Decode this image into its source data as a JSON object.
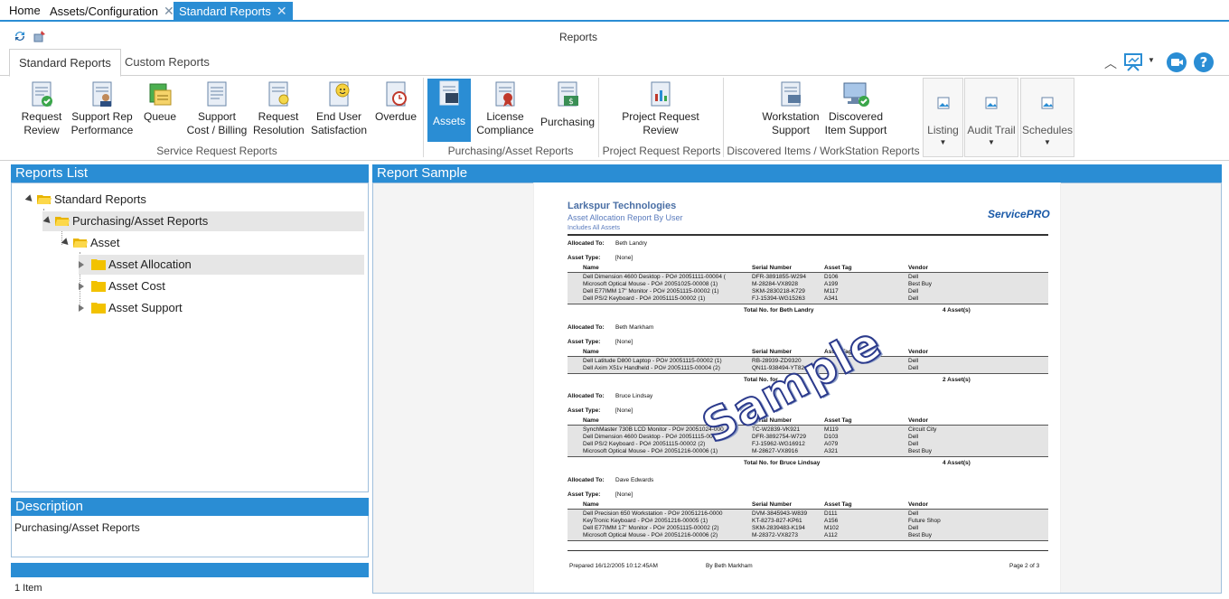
{
  "doc_tabs": [
    {
      "label": "Home"
    },
    {
      "label": "Assets/Configuration"
    },
    {
      "label": "Standard Reports"
    }
  ],
  "app_title": "Reports",
  "ribbon_tabs": [
    "Standard Reports",
    "Custom Reports"
  ],
  "ribbon": {
    "service_request": {
      "label": "Service Request Reports",
      "buttons": [
        {
          "line1": "Request",
          "line2": "Review"
        },
        {
          "line1": "Support Rep",
          "line2": "Performance"
        },
        {
          "line1": "Queue",
          "line2": ""
        },
        {
          "line1": "Support",
          "line2": "Cost / Billing"
        },
        {
          "line1": "Request",
          "line2": "Resolution"
        },
        {
          "line1": "End User",
          "line2": "Satisfaction"
        },
        {
          "line1": "Overdue",
          "line2": ""
        }
      ]
    },
    "purchasing": {
      "label": "Purchasing/Asset Reports",
      "buttons": [
        {
          "line1": "Assets",
          "line2": ""
        },
        {
          "line1": "License",
          "line2": "Compliance"
        },
        {
          "line1": "Purchasing",
          "line2": ""
        }
      ]
    },
    "project": {
      "label": "Project Request Reports",
      "buttons": [
        {
          "line1": "Project Request",
          "line2": "Review"
        }
      ]
    },
    "discovered": {
      "label": "Discovered Items / WorkStation Reports",
      "buttons": [
        {
          "line1": "Workstation",
          "line2": "Support"
        },
        {
          "line1": "Discovered",
          "line2": "Item Support"
        }
      ]
    },
    "dropdowns": [
      "Listing",
      "Audit Trail",
      "Schedules"
    ]
  },
  "reports_list": {
    "title": "Reports List",
    "items": [
      "Standard Reports",
      "Purchasing/Asset Reports",
      "Asset",
      "Asset Allocation",
      "Asset Cost",
      "Asset Support"
    ]
  },
  "description": {
    "title": "Description",
    "text": "Purchasing/Asset Reports"
  },
  "status": {
    "text": "1 Item"
  },
  "report_sample": {
    "title": "Report Sample",
    "company": "Larkspur Technologies",
    "subtitle": "Asset Allocation Report By User",
    "subtitle2": "Includes All Assets",
    "logo": "ServicePRO",
    "watermark": "Sample",
    "labels": {
      "allocated_to": "Allocated To:",
      "asset_type": "Asset Type:",
      "name": "Name",
      "serial": "Serial Number",
      "tag": "Asset Tag",
      "vendor": "Vendor"
    },
    "groups": [
      {
        "user": "Beth Landry",
        "asset_type": "[None]",
        "rows": [
          [
            "Dell Dimension 4600 Desktop - PO# 20051111-00004 (",
            "DFR-3891855-W294",
            "D106",
            "Dell"
          ],
          [
            "Microsoft Optical Mouse - PO# 20051025-00008 (1)",
            "M-28284-VX8928",
            "A199",
            "Best Buy"
          ],
          [
            "Dell E77IMM 17\" Monitor - PO# 20051115-00002 (1)",
            "SKM-2830218-K729",
            "M117",
            "Dell"
          ],
          [
            "Dell PS/2 Keyboard - PO# 20051115-00002 (1)",
            "FJ-15394-WG15263",
            "A341",
            "Dell"
          ]
        ],
        "total": "Total No. for  Beth Landry",
        "count": "4  Asset(s)"
      },
      {
        "user": "Beth Markham",
        "asset_type": "[None]",
        "rows": [
          [
            "Dell Latitude D800 Laptop - PO# 20051115-00002 (1)",
            "RB-28939-ZD9320",
            "",
            "Dell"
          ],
          [
            "Dell Axim X51v Handheld - PO# 20051115-00004 (2)",
            "QN11-938494-YT82",
            "",
            "Dell"
          ]
        ],
        "total": "Total No. for",
        "count": "2  Asset(s)"
      },
      {
        "user": "Bruce Lindsay",
        "asset_type": "[None]",
        "rows": [
          [
            "SynchMaster 730B LCD Monitor - PO# 20051024-000",
            "TC-W2839-VK921",
            "M119",
            "Circuit City"
          ],
          [
            "Dell Dimension 4600 Desktop - PO# 20051115-0000",
            "DFR-3892754-W729",
            "D103",
            "Dell"
          ],
          [
            "Dell PS/2 Keyboard - PO# 20051115-00002 (2)",
            "FJ-15962-WG16912",
            "A079",
            "Dell"
          ],
          [
            "Microsoft Optical Mouse - PO# 20051216-00006 (1)",
            "M-28627-VX8916",
            "A321",
            "Best Buy"
          ]
        ],
        "total": "Total No. for  Bruce Lindsay",
        "count": "4  Asset(s)"
      },
      {
        "user": "Dave Edwards",
        "asset_type": "[None]",
        "rows": [
          [
            "Dell Precision 650 Workstation - PO# 20051216-0000",
            "DVM-3845943-W839",
            "D111",
            "Dell"
          ],
          [
            "KeyTronic Keyboard - PO# 20051216-00005 (1)",
            "KT-8273-827-KP61",
            "A156",
            "Future Shop"
          ],
          [
            "Dell E77IMM 17\" Monitor - PO# 20051115-00002 (2)",
            "SKM-2839483-K194",
            "M102",
            "Dell"
          ],
          [
            "Microsoft Optical Mouse - PO# 20051216-00006 (2)",
            "M-28372-VX8273",
            "A112",
            "Best Buy"
          ]
        ]
      }
    ],
    "footer": {
      "prepared": "Prepared 16/12/2005  10:12:45AM",
      "by": "By Beth Markham",
      "page": "Page 2 of 3"
    }
  },
  "colors": {
    "accent": "#2a8dd4",
    "highlight": "#e6e6e6",
    "folder": "#f2c200"
  }
}
